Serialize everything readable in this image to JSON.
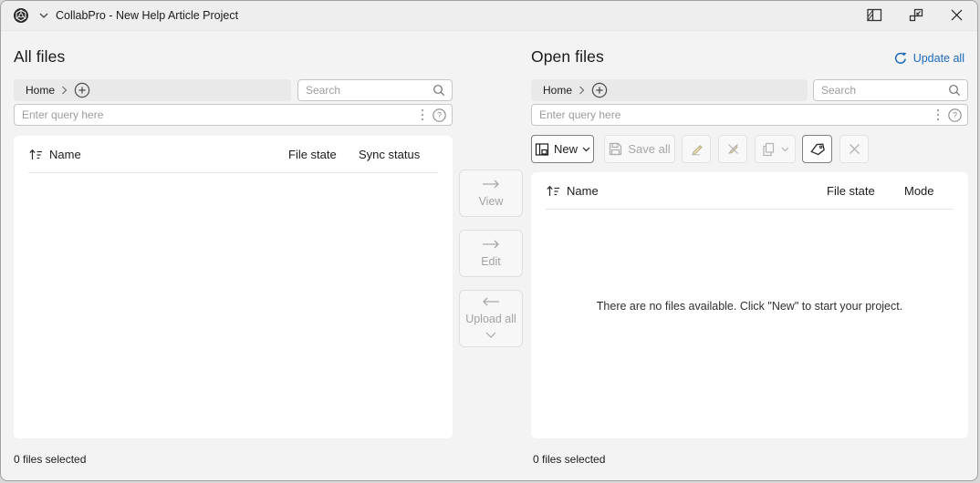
{
  "window": {
    "title": "CollabPro - New Help Article Project"
  },
  "left_panel": {
    "title": "All files",
    "breadcrumb_home": "Home",
    "search_placeholder": "Search",
    "query_placeholder": "Enter query here",
    "columns": [
      "Name",
      "File state",
      "Sync status"
    ],
    "status": "0 files selected"
  },
  "transfer_buttons": {
    "view": "View",
    "edit": "Edit",
    "upload_all": "Upload all"
  },
  "right_panel": {
    "title": "Open files",
    "update_all_label": "Update all",
    "breadcrumb_home": "Home",
    "search_placeholder": "Search",
    "query_placeholder": "Enter query here",
    "toolbar": {
      "new_label": "New",
      "save_all_label": "Save all"
    },
    "columns": [
      "Name",
      "File state",
      "Mode"
    ],
    "empty_message": "There are no files available. Click \"New\" to start your project.",
    "status": "0 files selected"
  },
  "colors": {
    "accent_blue": "#1c68b8"
  }
}
